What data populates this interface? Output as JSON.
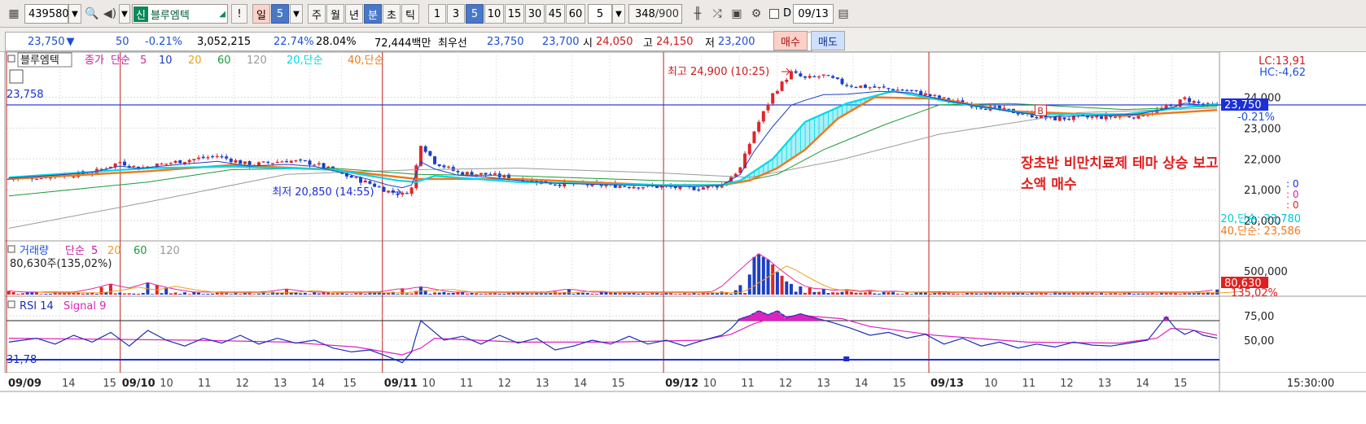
{
  "toolbar": {
    "code": "439580",
    "badge": "신",
    "name": "블루엠텍",
    "flag": "!",
    "period_il": "일",
    "period_value": "5",
    "periods": [
      "주",
      "월",
      "년",
      "분",
      "초",
      "틱"
    ],
    "intervals": [
      "1",
      "3",
      "5",
      "10",
      "15",
      "30",
      "45",
      "60"
    ],
    "count": "5",
    "shown": "348",
    "total": "/900",
    "date_label": "D",
    "date": "09/13"
  },
  "quote": {
    "price": "23,750",
    "down_arrow": "▼",
    "change": "50",
    "rate": "-0.21%",
    "volume": "3,052,215",
    "ratio1": "22.74%",
    "ratio2": "28.04%",
    "amount": "72,444백만",
    "best_label": "최우선",
    "ask": "23,750",
    "bid": "23,700",
    "open_label": "시",
    "open": "24,050",
    "high_label": "고",
    "high": "24,150",
    "low_label": "저",
    "low": "23,200",
    "buy": "매수",
    "sell": "매도"
  },
  "colors": {
    "up": "#e0252b",
    "down": "#1c3fc4",
    "ma5": "#e02aa0",
    "ma10": "#1c3fc4",
    "ma20": "#00d8e8",
    "ma40": "#f07818",
    "ma60": "#1a9a3a",
    "ma120": "#9a9a9a",
    "current": "#1a2fd6",
    "event": "#c02020"
  },
  "chart_data": [
    {
      "type": "candlestick",
      "title": "블루엠텍",
      "legend": [
        "종가",
        "단순",
        "5",
        "10",
        "20",
        "60",
        "120",
        "20,단순",
        "40,단순"
      ],
      "ylim": [
        19500,
        25200
      ],
      "y_ticks": [
        "24,000",
        "23,000",
        "22,000",
        "21,000",
        "20,000"
      ],
      "y_tick_values": [
        24000,
        23000,
        22000,
        21000,
        20000
      ],
      "current_line": 23750,
      "current_line_label": "23,758",
      "current_price_tag": "23,750",
      "current_rate_tag": "-0.21%",
      "lc": "LC:13,91",
      "hc": "HC:-4,62",
      "max_annotation": "최고 24,900 (10:25)",
      "min_annotation": "최저 20,850 (14:55)",
      "note_line1": "장초반 비만치료제 테마 상승 보고",
      "note_line2": "소액 매수",
      "marker": "B",
      "zero_readouts": [
        ": 0",
        ": 0",
        ": 0"
      ],
      "ma20_readout": "20,단순: 23,780",
      "ma40_readout": "40,단순: 23,586",
      "price_path": [
        [
          0,
          21350
        ],
        [
          10,
          21450
        ],
        [
          18,
          21550
        ],
        [
          24,
          21900
        ],
        [
          28,
          21700
        ],
        [
          32,
          21800
        ],
        [
          38,
          21950
        ],
        [
          45,
          22100
        ],
        [
          52,
          21800
        ],
        [
          60,
          21950
        ],
        [
          66,
          21850
        ],
        [
          72,
          21500
        ],
        [
          78,
          21200
        ],
        [
          82,
          20950
        ],
        [
          85,
          20850
        ],
        [
          87,
          21050
        ],
        [
          89,
          22500
        ],
        [
          92,
          21900
        ],
        [
          97,
          21550
        ],
        [
          103,
          21500
        ],
        [
          110,
          21350
        ],
        [
          118,
          21200
        ],
        [
          128,
          21150
        ],
        [
          140,
          21100
        ],
        [
          148,
          21050
        ],
        [
          154,
          21150
        ],
        [
          158,
          21700
        ],
        [
          161,
          22900
        ],
        [
          165,
          24100
        ],
        [
          169,
          24800
        ],
        [
          172,
          24600
        ],
        [
          176,
          24700
        ],
        [
          181,
          24400
        ],
        [
          188,
          24300
        ],
        [
          195,
          24200
        ],
        [
          203,
          23900
        ],
        [
          210,
          23700
        ],
        [
          218,
          23500
        ],
        [
          225,
          23300
        ],
        [
          234,
          23350
        ],
        [
          244,
          23400
        ],
        [
          251,
          23700
        ],
        [
          254,
          23950
        ],
        [
          258,
          23750
        ],
        [
          261,
          23700
        ]
      ],
      "ma20_path": [
        [
          0,
          21400
        ],
        [
          30,
          21700
        ],
        [
          48,
          21750
        ],
        [
          70,
          21650
        ],
        [
          84,
          21300
        ],
        [
          88,
          21250
        ],
        [
          92,
          21450
        ],
        [
          110,
          21250
        ],
        [
          140,
          21150
        ],
        [
          154,
          21150
        ],
        [
          158,
          21300
        ],
        [
          165,
          22000
        ],
        [
          172,
          23200
        ],
        [
          181,
          23800
        ],
        [
          191,
          24200
        ],
        [
          205,
          23800
        ],
        [
          221,
          23450
        ],
        [
          241,
          23450
        ],
        [
          261,
          23780
        ]
      ],
      "ma40_path": [
        [
          0,
          21350
        ],
        [
          30,
          21600
        ],
        [
          48,
          21800
        ],
        [
          70,
          21650
        ],
        [
          88,
          21350
        ],
        [
          110,
          21350
        ],
        [
          140,
          21150
        ],
        [
          154,
          21150
        ],
        [
          160,
          21300
        ],
        [
          166,
          21700
        ],
        [
          172,
          22300
        ],
        [
          179,
          23300
        ],
        [
          187,
          24000
        ],
        [
          201,
          23950
        ],
        [
          216,
          23550
        ],
        [
          241,
          23400
        ],
        [
          261,
          23586
        ]
      ],
      "ma60_path": [
        [
          0,
          20800
        ],
        [
          30,
          21250
        ],
        [
          48,
          21650
        ],
        [
          70,
          21700
        ],
        [
          88,
          21500
        ],
        [
          110,
          21450
        ],
        [
          140,
          21300
        ],
        [
          158,
          21250
        ],
        [
          166,
          21500
        ],
        [
          176,
          22300
        ],
        [
          189,
          23100
        ],
        [
          201,
          23750
        ],
        [
          216,
          23800
        ],
        [
          241,
          23600
        ],
        [
          261,
          23700
        ]
      ],
      "ma120_path": [
        [
          0,
          19750
        ],
        [
          30,
          20600
        ],
        [
          60,
          21500
        ],
        [
          88,
          21650
        ],
        [
          110,
          21700
        ],
        [
          140,
          21550
        ],
        [
          160,
          21400
        ],
        [
          179,
          21950
        ],
        [
          201,
          22800
        ],
        [
          231,
          23500
        ],
        [
          261,
          23650
        ]
      ],
      "x_ticks": [
        "09/09",
        "14",
        "15",
        "09/10",
        "10",
        "11",
        "12",
        "13",
        "14",
        "15",
        "09/11",
        "10",
        "11",
        "12",
        "13",
        "14",
        "15",
        "09/12",
        "10",
        "11",
        "12",
        "13",
        "14",
        "15",
        "09/13",
        "10",
        "11",
        "12",
        "13",
        "14",
        "15"
      ],
      "x_tick_major": [
        "09/09",
        "09/10",
        "09/11",
        "09/12",
        "09/13"
      ],
      "x_end_label": "15:30:00"
    },
    {
      "type": "bar",
      "title": "거래량",
      "legend": [
        "단순",
        "5",
        "20",
        "60",
        "120"
      ],
      "readout": "80,630주(135,02%)",
      "y_tick": "500,000",
      "volume_tag": "80,630",
      "volume_rate_tag": "135,02%",
      "ylim": [
        0,
        700000
      ],
      "spikes": [
        [
          0,
          60000
        ],
        [
          20,
          120000
        ],
        [
          22,
          170000
        ],
        [
          30,
          190000
        ],
        [
          32,
          150000
        ],
        [
          34,
          110000
        ],
        [
          60,
          90000
        ],
        [
          85,
          100000
        ],
        [
          88,
          60000
        ],
        [
          89,
          130000
        ],
        [
          90,
          70000
        ],
        [
          121,
          90000
        ],
        [
          157,
          70000
        ],
        [
          158,
          150000
        ],
        [
          160,
          320000
        ],
        [
          161,
          600000
        ],
        [
          162,
          650000
        ],
        [
          163,
          600000
        ],
        [
          164,
          560000
        ],
        [
          165,
          480000
        ],
        [
          166,
          360000
        ],
        [
          167,
          300000
        ],
        [
          168,
          210000
        ],
        [
          169,
          170000
        ],
        [
          171,
          130000
        ],
        [
          173,
          110000
        ],
        [
          176,
          90000
        ],
        [
          181,
          85000
        ],
        [
          186,
          70000
        ],
        [
          191,
          60000
        ],
        [
          201,
          50000
        ],
        [
          221,
          40000
        ],
        [
          241,
          30000
        ],
        [
          261,
          80630
        ]
      ]
    },
    {
      "type": "line",
      "title": "RSI 14",
      "legend": [
        "RSI 14",
        "Signal 9"
      ],
      "readout": "31,78",
      "ylim": [
        20,
        90
      ],
      "y_ticks": [
        "75,00",
        "50,00"
      ],
      "y_tick_values": [
        75,
        50
      ],
      "upper_band": 70,
      "lower_band": 30,
      "rsi_path": [
        [
          0,
          48
        ],
        [
          6,
          52
        ],
        [
          10,
          46
        ],
        [
          14,
          55
        ],
        [
          18,
          48
        ],
        [
          22,
          58
        ],
        [
          26,
          44
        ],
        [
          30,
          60
        ],
        [
          34,
          50
        ],
        [
          38,
          44
        ],
        [
          42,
          52
        ],
        [
          46,
          47
        ],
        [
          50,
          55
        ],
        [
          54,
          46
        ],
        [
          58,
          52
        ],
        [
          62,
          47
        ],
        [
          66,
          50
        ],
        [
          70,
          42
        ],
        [
          74,
          38
        ],
        [
          78,
          40
        ],
        [
          82,
          33
        ],
        [
          85,
          27
        ],
        [
          87,
          38
        ],
        [
          88,
          55
        ],
        [
          89,
          70
        ],
        [
          91,
          62
        ],
        [
          94,
          50
        ],
        [
          98,
          54
        ],
        [
          102,
          46
        ],
        [
          106,
          55
        ],
        [
          110,
          47
        ],
        [
          114,
          52
        ],
        [
          118,
          40
        ],
        [
          122,
          44
        ],
        [
          126,
          50
        ],
        [
          130,
          46
        ],
        [
          134,
          54
        ],
        [
          138,
          46
        ],
        [
          142,
          50
        ],
        [
          146,
          44
        ],
        [
          150,
          50
        ],
        [
          154,
          55
        ],
        [
          156,
          62
        ],
        [
          158,
          72
        ],
        [
          160,
          75
        ],
        [
          162,
          80
        ],
        [
          164,
          76
        ],
        [
          166,
          80
        ],
        [
          168,
          73
        ],
        [
          171,
          77
        ],
        [
          174,
          73
        ],
        [
          178,
          68
        ],
        [
          182,
          62
        ],
        [
          186,
          55
        ],
        [
          190,
          58
        ],
        [
          194,
          52
        ],
        [
          198,
          56
        ],
        [
          202,
          46
        ],
        [
          206,
          52
        ],
        [
          210,
          44
        ],
        [
          214,
          48
        ],
        [
          218,
          42
        ],
        [
          222,
          46
        ],
        [
          226,
          43
        ],
        [
          230,
          48
        ],
        [
          234,
          45
        ],
        [
          238,
          44
        ],
        [
          242,
          47
        ],
        [
          246,
          50
        ],
        [
          250,
          74
        ],
        [
          252,
          62
        ],
        [
          254,
          56
        ],
        [
          256,
          60
        ],
        [
          258,
          55
        ],
        [
          261,
          52
        ]
      ],
      "signal_path": [
        [
          0,
          52
        ],
        [
          20,
          51
        ],
        [
          40,
          50
        ],
        [
          60,
          48
        ],
        [
          75,
          43
        ],
        [
          85,
          35
        ],
        [
          89,
          42
        ],
        [
          92,
          52
        ],
        [
          110,
          48
        ],
        [
          130,
          48
        ],
        [
          150,
          50
        ],
        [
          156,
          56
        ],
        [
          161,
          67
        ],
        [
          166,
          74
        ],
        [
          172,
          75
        ],
        [
          180,
          72
        ],
        [
          186,
          64
        ],
        [
          200,
          55
        ],
        [
          220,
          48
        ],
        [
          240,
          47
        ],
        [
          248,
          52
        ],
        [
          251,
          62
        ],
        [
          255,
          61
        ],
        [
          261,
          55
        ]
      ]
    }
  ]
}
